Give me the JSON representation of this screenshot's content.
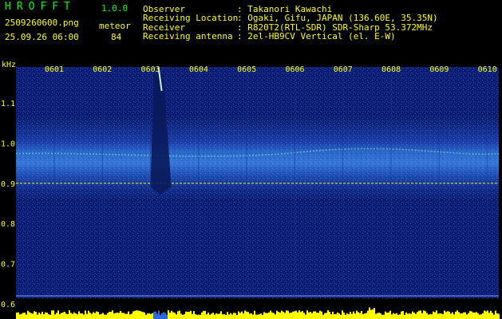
{
  "header": {
    "app_name": "HROFFT",
    "version": "1.0.0",
    "filename": "2509260600.png",
    "datetime": "25.09.26 06:00",
    "meteor_label": "meteor",
    "meteor_count": "84",
    "observer_label": "Observer",
    "observer_value": ": Takanori Kawachi",
    "location_label": "Receiving Location",
    "location_value": ": Ogaki, Gifu, JAPAN (136.60E, 35.35N)",
    "receiver_label": "Receiver",
    "receiver_value": ": R820T2(RTL-SDR) SDR-Sharp 53.372MHz",
    "antenna_label": "Receiving antenna",
    "antenna_value": ": 2el-HB9CV Vertical (el. E-W)"
  },
  "colors": {
    "background": "#000000",
    "spectrum_low": "#0a1a6a",
    "spectrum_mid": "#2a6ad8",
    "spectrum_high": "#7fe0ff",
    "signal": "#ffff00",
    "axis_text": "#ffff00"
  },
  "chart_data": {
    "type": "heatmap",
    "ylabel": "kHz",
    "y_ticks": [
      "1.1",
      "1.0",
      "0.9",
      "0.8",
      "0.7",
      "0.6"
    ],
    "ylim": [
      0.6,
      1.15
    ],
    "x_ticks": [
      "0601",
      "0602",
      "0603",
      "0604",
      "0605",
      "0606",
      "0607",
      "0608",
      "0609",
      "0610"
    ],
    "carrier_khz": 0.9,
    "band_center_khz": 0.97,
    "meteor_event_time": "0603"
  }
}
